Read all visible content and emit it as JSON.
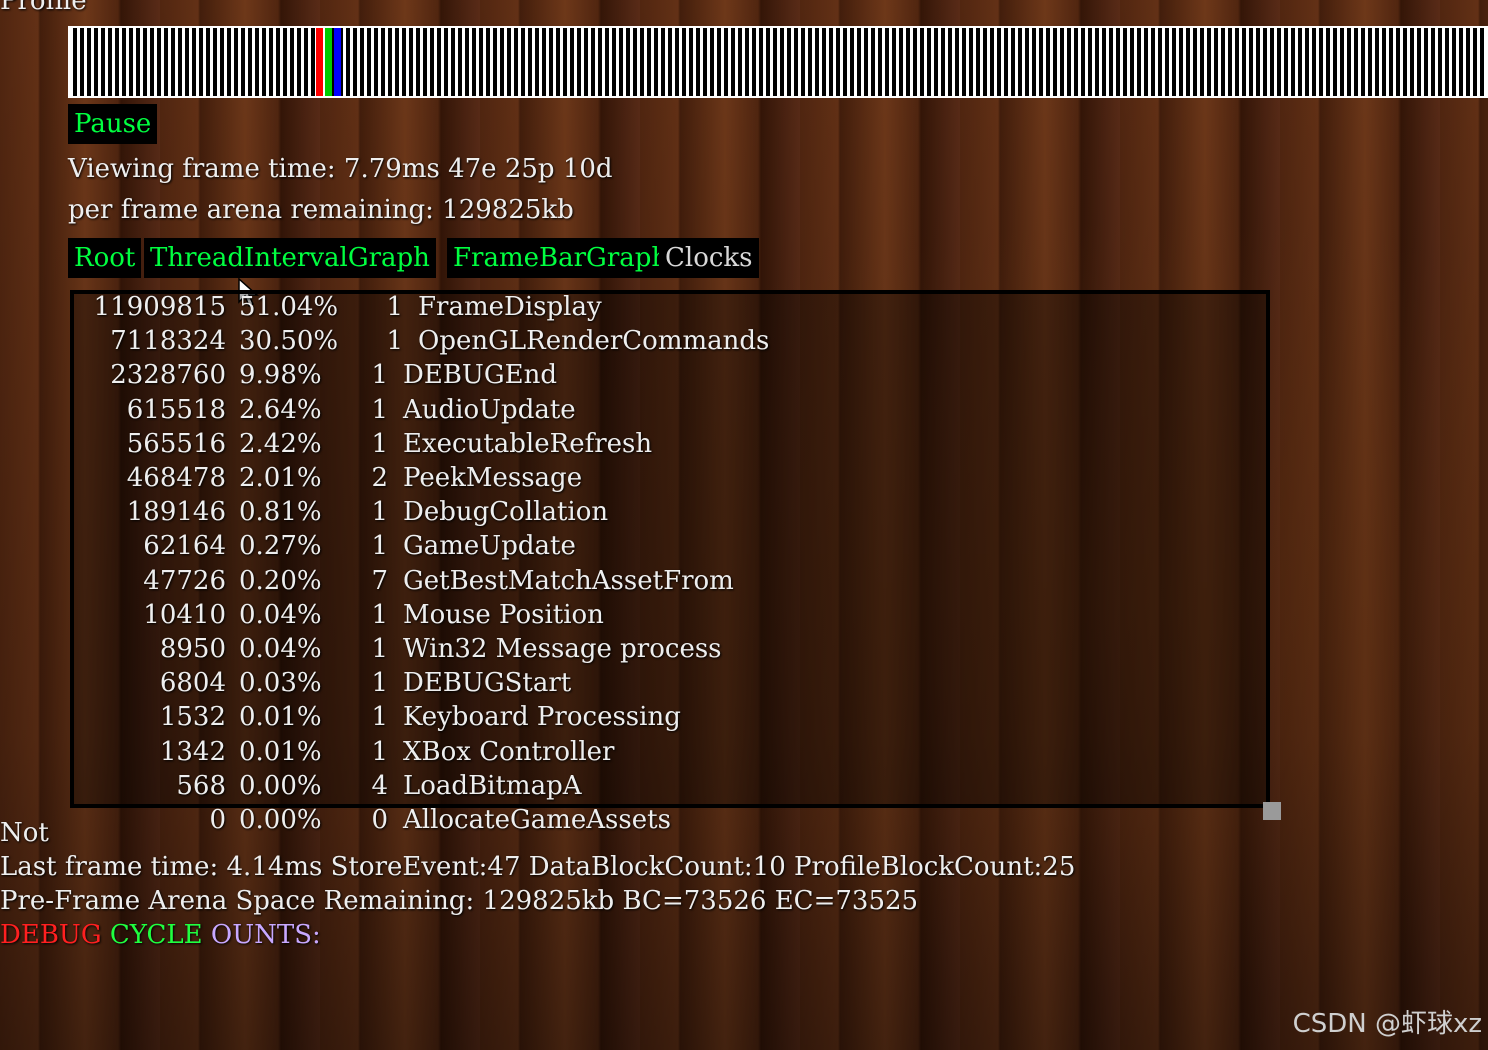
{
  "profile_title": "Profile",
  "timeline": {
    "markers": [
      {
        "color": "#ff0000"
      },
      {
        "color": "#00cc00"
      },
      {
        "color": "#0000ff"
      }
    ]
  },
  "pause_label": "Pause",
  "viewing_frame_time": "Viewing frame time: 7.79ms 47e 25p 10d",
  "arena_remaining": "per frame arena remaining: 129825kb",
  "tabs": [
    {
      "label": "Root",
      "active": true
    },
    {
      "label": "ThreadIntervalGraph",
      "active": true
    },
    {
      "label": "FrameBarGraph",
      "active": true
    },
    {
      "label": "Clocks",
      "active": false
    }
  ],
  "clock_rows": [
    {
      "cycles": "11909815",
      "percent": "51.04%",
      "count": "1",
      "name": "FrameDisplay"
    },
    {
      "cycles": "7118324",
      "percent": "30.50%",
      "count": "1",
      "name": "OpenGLRenderCommands"
    },
    {
      "cycles": "2328760",
      "percent": "9.98%",
      "count": "1",
      "name": "DEBUGEnd"
    },
    {
      "cycles": "615518",
      "percent": "2.64%",
      "count": "1",
      "name": "AudioUpdate"
    },
    {
      "cycles": "565516",
      "percent": "2.42%",
      "count": "1",
      "name": "ExecutableRefresh"
    },
    {
      "cycles": "468478",
      "percent": "2.01%",
      "count": "2",
      "name": "PeekMessage"
    },
    {
      "cycles": "189146",
      "percent": "0.81%",
      "count": "1",
      "name": "DebugCollation"
    },
    {
      "cycles": "62164",
      "percent": "0.27%",
      "count": "1",
      "name": "GameUpdate"
    },
    {
      "cycles": "47726",
      "percent": "0.20%",
      "count": "7",
      "name": "GetBestMatchAssetFrom"
    },
    {
      "cycles": "10410",
      "percent": "0.04%",
      "count": "1",
      "name": "Mouse Position"
    },
    {
      "cycles": "8950",
      "percent": "0.04%",
      "count": "1",
      "name": "Win32 Message process"
    },
    {
      "cycles": "6804",
      "percent": "0.03%",
      "count": "1",
      "name": "DEBUGStart"
    },
    {
      "cycles": "1532",
      "percent": "0.01%",
      "count": "1",
      "name": "Keyboard Processing"
    },
    {
      "cycles": "1342",
      "percent": "0.01%",
      "count": "1",
      "name": "XBox Controller"
    },
    {
      "cycles": "568",
      "percent": "0.00%",
      "count": "4",
      "name": "LoadBitmapA"
    },
    {
      "cycles": "0",
      "percent": "0.00%",
      "count": "0",
      "name": "AllocateGameAssets"
    }
  ],
  "not_label": "Not",
  "last_frame_time": "Last frame time: 4.14ms StoreEvent:47 DataBlockCount:10 ProfileBlockCount:25",
  "pre_frame_arena": "Pre-Frame Arena Space Remaining: 129825kb BC=73526 EC=73525",
  "debug_cycle_counts": {
    "part1": "DEBUG",
    "part1_color": "#ff2020",
    "part2": "CYCLE",
    "part2_color": "#20ff40",
    "part3": "OUNTS:",
    "part3_color": "#c8a8ff"
  },
  "watermark": "CSDN @虾球xz"
}
